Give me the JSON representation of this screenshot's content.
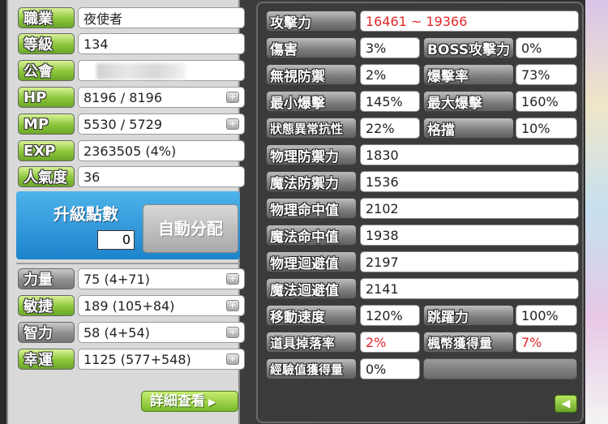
{
  "char": {
    "job_label": "職業",
    "job": "夜使者",
    "level_label": "等級",
    "level": "134",
    "guild_label": "公會",
    "guild": "",
    "hp_label": "HP",
    "hp": "8196 / 8196",
    "mp_label": "MP",
    "mp": "5530 / 5729",
    "exp_label": "EXP",
    "exp": "2363505 (4%)",
    "fame_label": "人氣度",
    "fame": "36"
  },
  "ap": {
    "title": "升級點數",
    "value": "0",
    "auto_label": "自動分配"
  },
  "stats": {
    "str_label": "力量",
    "str": "75 (4+71)",
    "dex_label": "敏捷",
    "dex": "189 (105+84)",
    "int_label": "智力",
    "int": "58 (4+54)",
    "luk_label": "幸運",
    "luk": "1125 (577+548)"
  },
  "detail_label": "詳細查看",
  "detail": {
    "atk_label": "攻擊力",
    "atk": "16461 ~ 19366",
    "dmg_label": "傷害",
    "dmg": "3%",
    "boss_label": "BOSS攻擊力",
    "boss": "0%",
    "ignore_label": "無視防禦",
    "ignore": "2%",
    "crit_label": "爆擊率",
    "crit": "73%",
    "mincrit_label": "最小爆擊",
    "mincrit": "145%",
    "maxcrit_label": "最大爆擊",
    "maxcrit": "160%",
    "status_label": "狀態異常抗性",
    "status": "22%",
    "block_label": "格擋",
    "block": "10%",
    "pdef_label": "物理防禦力",
    "pdef": "1830",
    "mdef_label": "魔法防禦力",
    "mdef": "1536",
    "pacc_label": "物理命中值",
    "pacc": "2102",
    "macc_label": "魔法命中值",
    "macc": "1938",
    "pavoid_label": "物理迴避值",
    "pavoid": "2197",
    "mavoid_label": "魔法迴避值",
    "mavoid": "2141",
    "speed_label": "移動速度",
    "speed": "120%",
    "jump_label": "跳躍力",
    "jump": "100%",
    "drop_label": "道具掉落率",
    "drop": "2%",
    "meso_label": "楓幣獲得量",
    "meso": "7%",
    "expgain_label": "經驗值獲得量",
    "expgain": "0%"
  },
  "icons": {
    "plus": "plus-icon",
    "back": "back-arrow-icon"
  },
  "colors": {
    "highlight_red": "#e0282a",
    "label_green": "#8cc63a",
    "ap_blue": "#1d83cc"
  }
}
